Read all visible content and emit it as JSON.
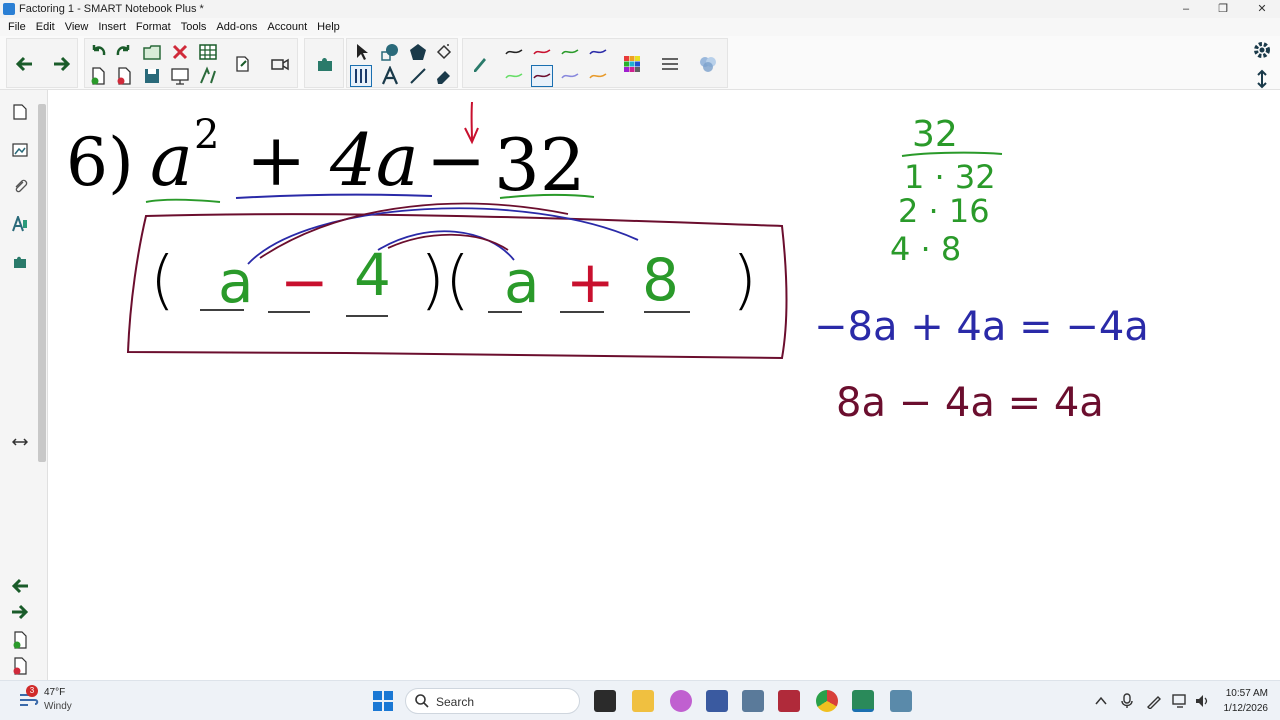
{
  "window": {
    "title": "Factoring 1 - SMART Notebook Plus *",
    "min": "‒",
    "max": "❐",
    "close": "✕"
  },
  "menu": [
    "File",
    "Edit",
    "View",
    "Insert",
    "Format",
    "Tools",
    "Add-ons",
    "Account",
    "Help"
  ],
  "colors": {
    "green": "#2a9a2a",
    "red": "#c8102e",
    "blue": "#2a2aa8",
    "maroon": "#6b0e2e",
    "accent": "#1a6fb0"
  },
  "canvas": {
    "problem": {
      "number": "6)",
      "base": "a",
      "exponent": "2",
      "plus": "+",
      "middle": "4a",
      "minus": "−",
      "constant": "32"
    },
    "factors": {
      "open1": "(",
      "v1": "a",
      "op1": "−",
      "n1": "4",
      "close1": ")(",
      "v2": "a",
      "op2": "+",
      "n2": "8",
      "close2": ")"
    },
    "factor_list": {
      "header": "32",
      "pairs": [
        "1 · 32",
        "2 · 16",
        "4 · 8"
      ]
    },
    "checks": {
      "line1": "−8a + 4a = −4a",
      "line2": "8a − 4a = 4a"
    }
  },
  "taskbar": {
    "weather": {
      "temp": "47°F",
      "condition": "Windy",
      "badge": "3"
    },
    "search": "Search",
    "time": "10:57 AM",
    "date": "1/12/2026"
  }
}
